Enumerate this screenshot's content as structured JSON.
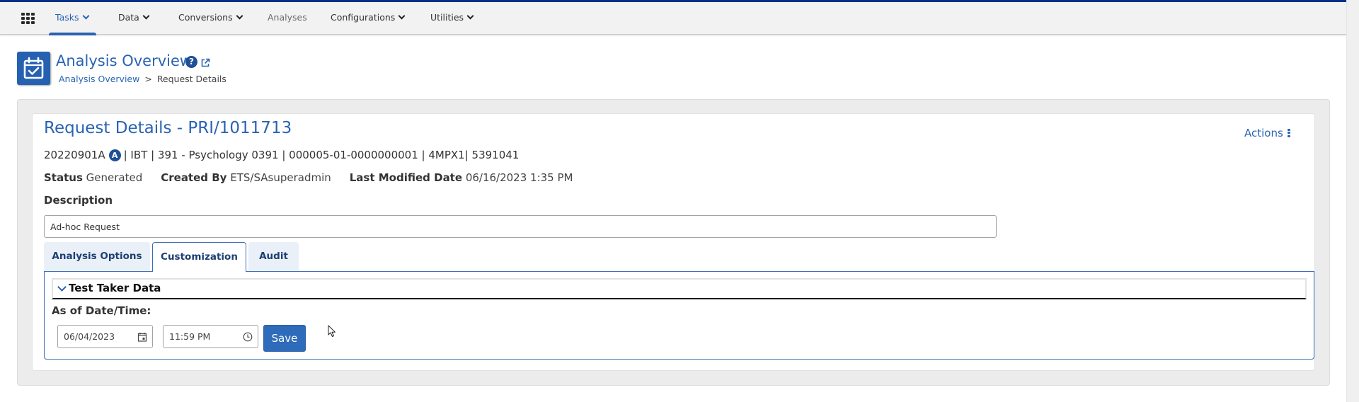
{
  "nav": {
    "items": [
      {
        "label": "Tasks",
        "has_dropdown": true,
        "active": true
      },
      {
        "label": "Data",
        "has_dropdown": true,
        "active": false
      },
      {
        "label": "Conversions",
        "has_dropdown": true,
        "active": false
      },
      {
        "label": "Analyses",
        "has_dropdown": false,
        "active": false
      },
      {
        "label": "Configurations",
        "has_dropdown": true,
        "active": false
      },
      {
        "label": "Utilities",
        "has_dropdown": true,
        "active": false
      }
    ],
    "app_menu_icon": "grid-icon"
  },
  "header": {
    "icon": "calendar-check-icon",
    "title": "Analysis Overview",
    "help_icon_glyph": "?",
    "breadcrumb": {
      "link": "Analysis Overview",
      "separator": ">",
      "current": "Request Details"
    }
  },
  "request": {
    "title": "Request Details - PRI/1011713",
    "actions_label": "Actions",
    "meta": {
      "code": "20220901A",
      "badge": "A",
      "rest": "| IBT | 391 - Psychology 0391 | 000005-01-0000000001 | 4MPX1| 5391041"
    },
    "status_label": "Status",
    "status_value": "Generated",
    "created_by_label": "Created By",
    "created_by_value": "ETS/SAsuperadmin",
    "last_modified_label": "Last Modified Date",
    "last_modified_value": "06/16/2023 1:35 PM",
    "description_label": "Description",
    "description_value": "Ad-hoc Request"
  },
  "tabs": [
    {
      "label": "Analysis Options",
      "active": false
    },
    {
      "label": "Customization",
      "active": true
    },
    {
      "label": "Audit",
      "active": false
    }
  ],
  "customization": {
    "section_title": "Test Taker Data",
    "section_expanded": true,
    "as_of_label": "As of Date/Time:",
    "date_value": "06/04/2023",
    "time_value": "11:59 PM",
    "save_label": "Save"
  },
  "colors": {
    "brand_dark": "#013087",
    "accent": "#2a63b3",
    "button": "#2e6bbb"
  }
}
